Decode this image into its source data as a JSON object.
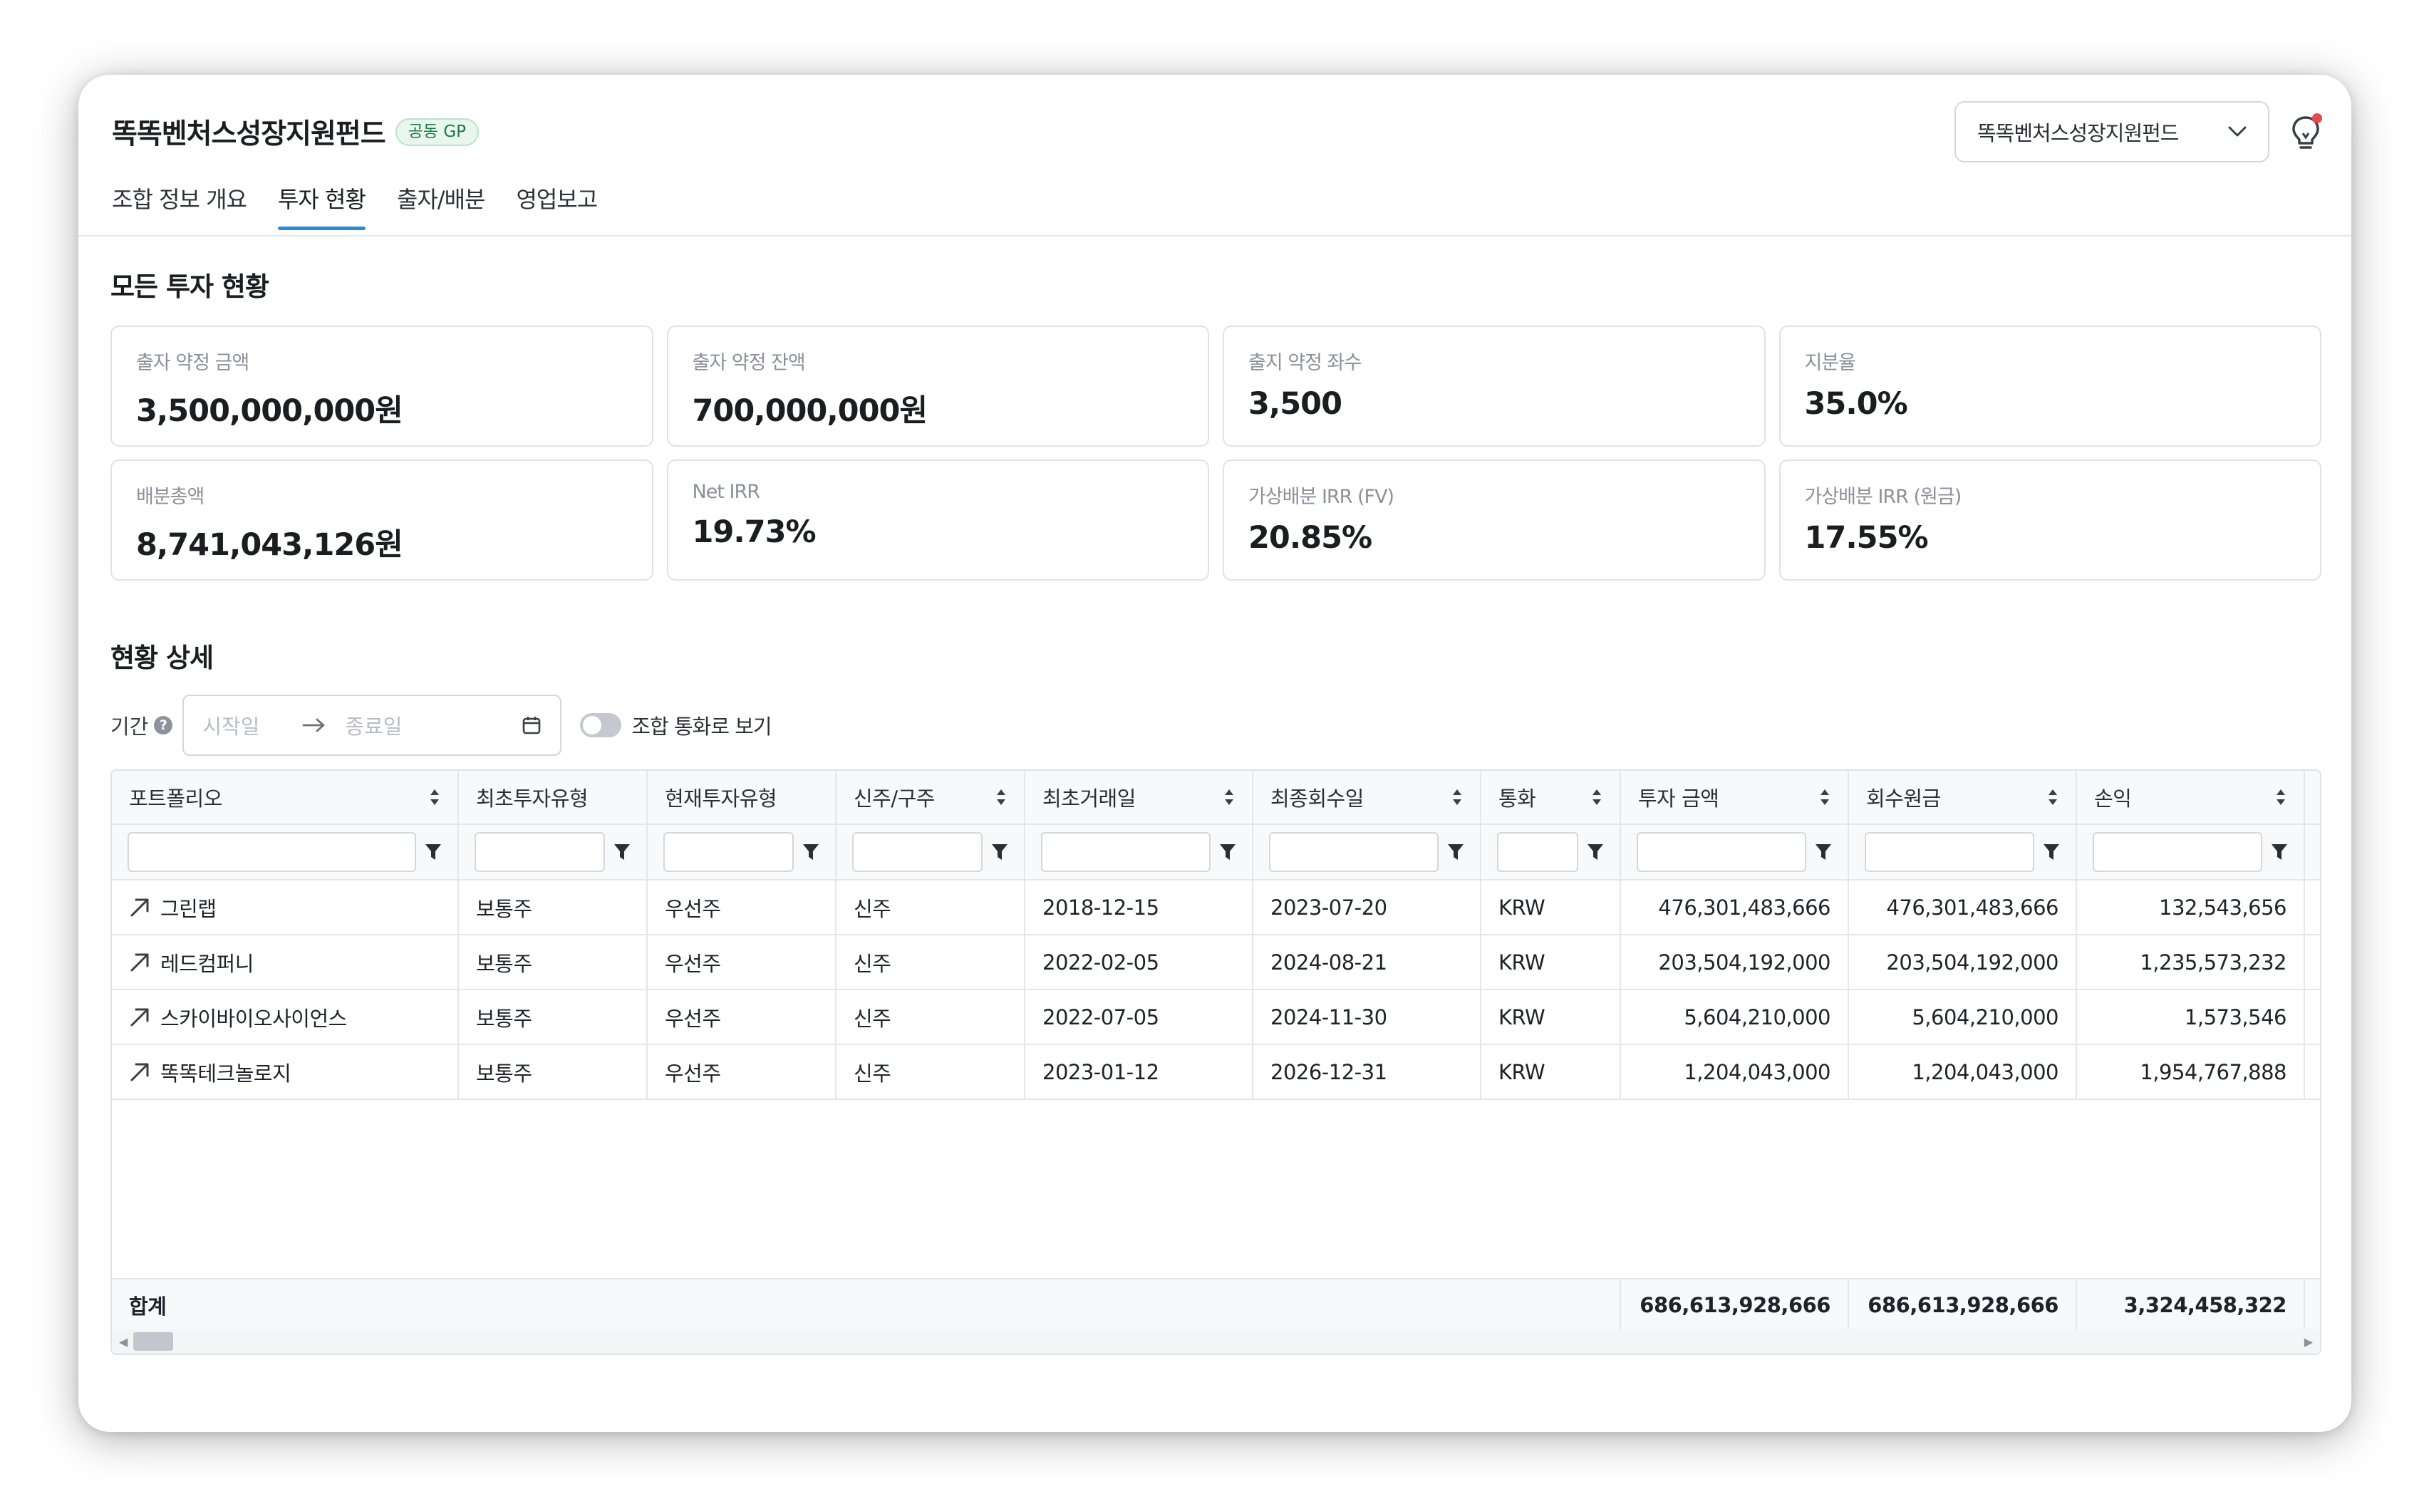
{
  "header": {
    "fund_title": "똑똑벤처스성장지원펀드",
    "badge": "공동 GP",
    "fund_select_value": "똑똑벤처스성장지원펀드"
  },
  "tabs": [
    {
      "label": "조합 정보 개요",
      "active": false
    },
    {
      "label": "투자 현황",
      "active": true
    },
    {
      "label": "출자/배분",
      "active": false
    },
    {
      "label": "영업보고",
      "active": false
    }
  ],
  "overview": {
    "title": "모든 투자 현황",
    "cards": [
      {
        "label": "출자 약정 금액",
        "value": "3,500,000,000원"
      },
      {
        "label": "출자 약정 잔액",
        "value": "700,000,000원"
      },
      {
        "label": "출지 약정 좌수",
        "value": "3,500"
      },
      {
        "label": "지분율",
        "value": "35.0%"
      },
      {
        "label": "배분총액",
        "value": "8,741,043,126원"
      },
      {
        "label": "Net IRR",
        "value": "19.73%"
      },
      {
        "label": "가상배분 IRR (FV)",
        "value": "20.85%"
      },
      {
        "label": "가상배분 IRR (원금)",
        "value": "17.55%"
      }
    ]
  },
  "detail": {
    "title": "현황 상세",
    "period_label": "기간",
    "start_placeholder": "시작일",
    "end_placeholder": "종료일",
    "toggle_label": "조합 통화로 보기"
  },
  "table": {
    "columns": [
      "포트폴리오",
      "최초투자유형",
      "현재투자유형",
      "신주/구주",
      "최초거래일",
      "최종회수일",
      "통화",
      "투자 금액",
      "회수원금",
      "손익"
    ],
    "rows": [
      [
        "그린랩",
        "보통주",
        "우선주",
        "신주",
        "2018-12-15",
        "2023-07-20",
        "KRW",
        "476,301,483,666",
        "476,301,483,666",
        "132,543,656"
      ],
      [
        "레드컴퍼니",
        "보통주",
        "우선주",
        "신주",
        "2022-02-05",
        "2024-08-21",
        "KRW",
        "203,504,192,000",
        "203,504,192,000",
        "1,235,573,232"
      ],
      [
        "스카이바이오사이언스",
        "보통주",
        "우선주",
        "신주",
        "2022-07-05",
        "2024-11-30",
        "KRW",
        "5,604,210,000",
        "5,604,210,000",
        "1,573,546"
      ],
      [
        "똑똑테크놀로지",
        "보통주",
        "우선주",
        "신주",
        "2023-01-12",
        "2026-12-31",
        "KRW",
        "1,204,043,000",
        "1,204,043,000",
        "1,954,767,888"
      ]
    ],
    "totals": {
      "label": "합계",
      "investment": "686,613,928,666",
      "recovered": "686,613,928,666",
      "pnl": "3,324,458,322"
    }
  },
  "colors": {
    "accent": "#2b8ad6",
    "badge_green": "#1f7a47"
  }
}
